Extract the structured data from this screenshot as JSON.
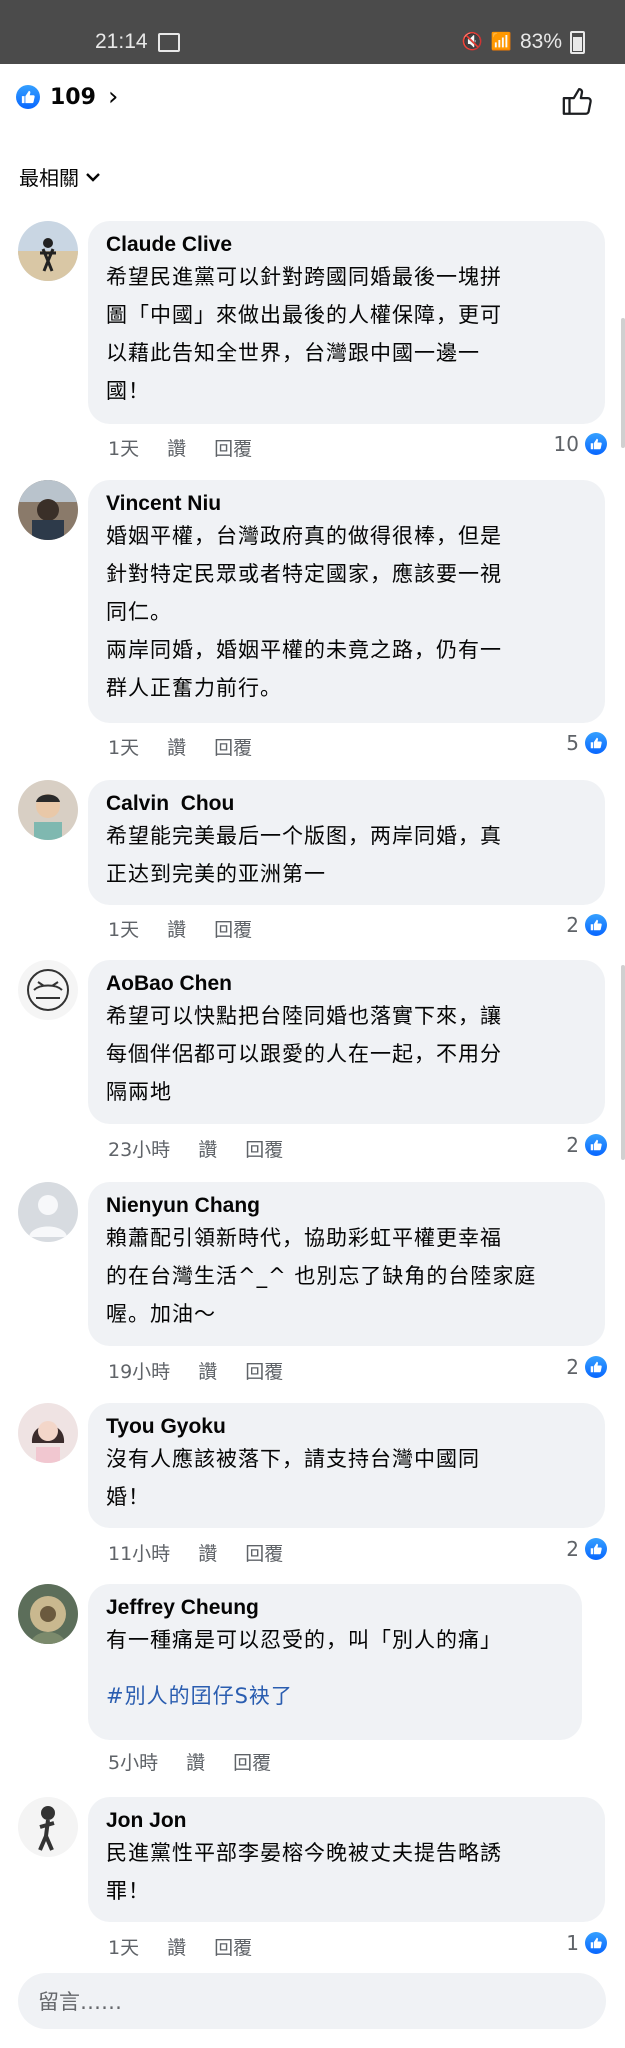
{
  "status": {
    "time": "21:14",
    "battery": "83%"
  },
  "reactions": {
    "count": "109"
  },
  "sort": {
    "label": "最相關"
  },
  "actions": {
    "like": "讚",
    "reply": "回覆"
  },
  "comments": [
    {
      "name": "Claude Clive",
      "lines": [
        "希望民進黨可以針對跨國同婚最後一塊拼",
        "圖「中國」來做出最後的人權保障，更可",
        "以藉此告知全世界，台灣跟中國一邊一",
        "國！"
      ],
      "time": "1天",
      "likes": "10"
    },
    {
      "name": "Vincent Niu",
      "lines": [
        "婚姻平權，台灣政府真的做得很棒，但是",
        "針對特定民眾或者特定國家，應該要一視",
        "同仁。",
        "兩岸同婚，婚姻平權的未竟之路，仍有一",
        "群人正奮力前行。"
      ],
      "time": "1天",
      "likes": "5"
    },
    {
      "name": "Calvin  Chou",
      "lines": [
        "希望能完美最后一个版图，两岸同婚，真",
        "正达到完美的亚洲第一"
      ],
      "time": "1天",
      "likes": "2"
    },
    {
      "name": "AoBao Chen",
      "lines": [
        "希望可以快點把台陸同婚也落實下來，讓",
        "每個伴侶都可以跟愛的人在一起，不用分",
        "隔兩地"
      ],
      "time": "23小時",
      "likes": "2"
    },
    {
      "name": "Nienyun Chang",
      "lines": [
        "賴蕭配引領新時代，協助彩虹平權更幸福",
        "的在台灣生活^_^ 也別忘了缺角的台陸家庭",
        "喔。加油～"
      ],
      "time": "19小時",
      "likes": "2"
    },
    {
      "name": "Tyou Gyoku",
      "lines": [
        "沒有人應該被落下，請支持台灣中國同",
        "婚！"
      ],
      "time": "11小時",
      "likes": "2"
    },
    {
      "name": "Jeffrey Cheung",
      "lines": [
        "有一種痛是可以忍受的，叫「別人的痛」"
      ],
      "hashtag": "#別人的囝仔S袂了",
      "time": "5小時",
      "likes": ""
    },
    {
      "name": "Jon Jon",
      "lines": [
        "民進黨性平部李晏榕今晚被丈夫提告略誘",
        "罪！"
      ],
      "time": "1天",
      "likes": "1"
    }
  ],
  "composer": {
    "placeholder": "留言……"
  },
  "colors": {
    "accent": "#0866ff",
    "bubble": "#f0f2f5",
    "hashtag": "#2a5db0"
  }
}
